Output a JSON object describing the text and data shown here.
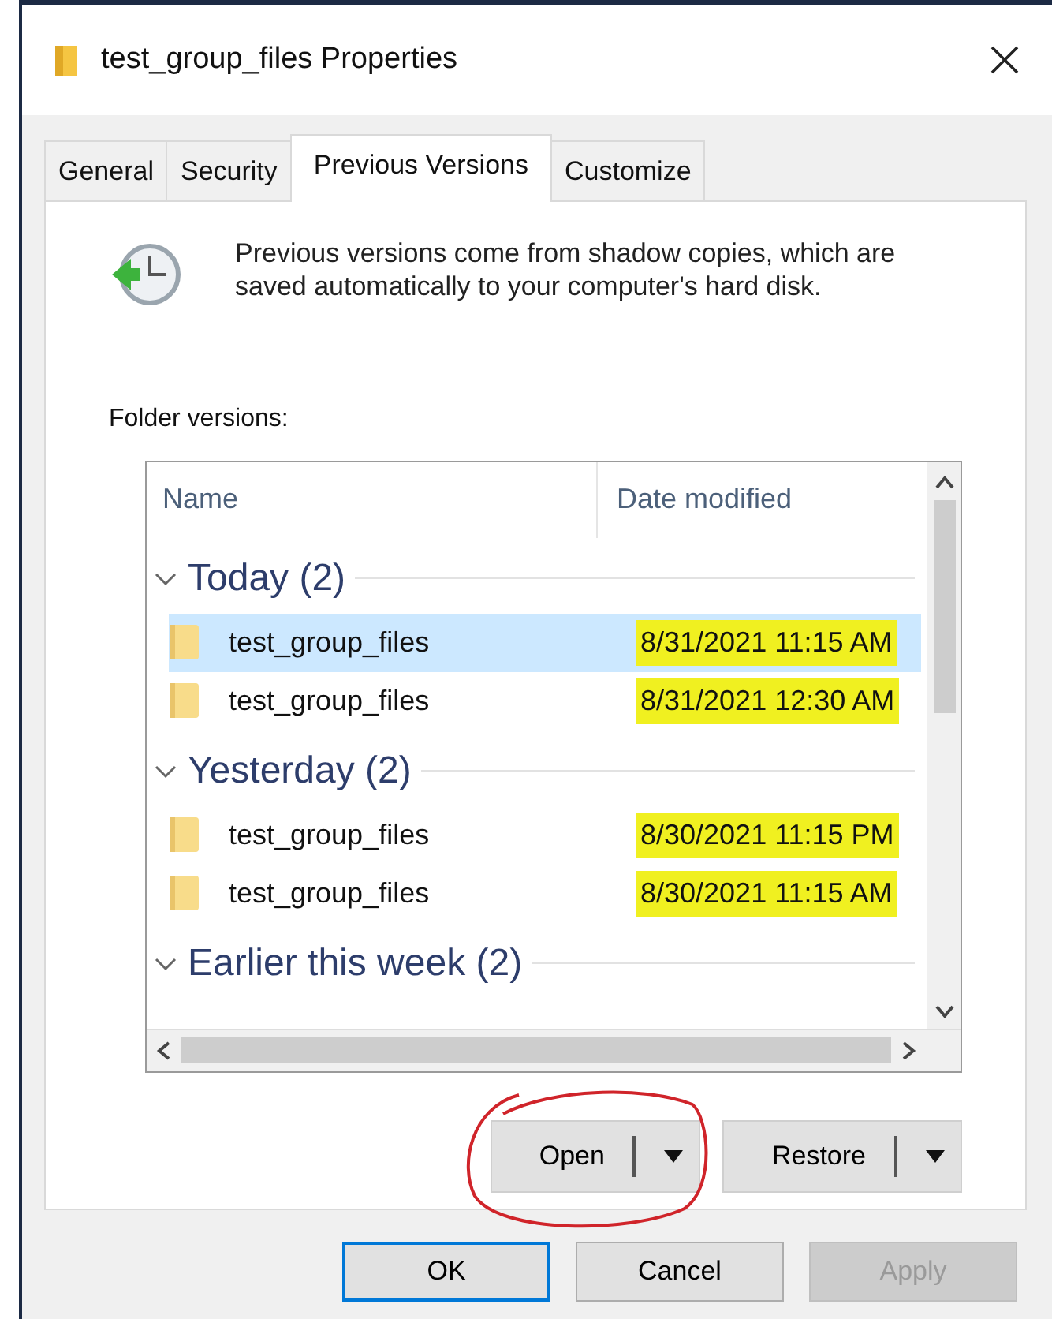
{
  "window": {
    "title": "test_group_files Properties"
  },
  "tabs": [
    {
      "label": "General",
      "selected": false
    },
    {
      "label": "Security",
      "selected": false
    },
    {
      "label": "Previous Versions",
      "selected": true
    },
    {
      "label": "Customize",
      "selected": false
    }
  ],
  "info_text": "Previous versions come from shadow copies, which are saved automatically to your computer's hard disk.",
  "list_label": "Folder versions:",
  "table": {
    "columns": [
      "Name",
      "Date modified"
    ],
    "groups": [
      {
        "label": "Today (2)",
        "expanded": true,
        "rows": [
          {
            "name": "test_group_files",
            "date": "8/31/2021 11:15 AM",
            "selected": true,
            "highlighted": true
          },
          {
            "name": "test_group_files",
            "date": "8/31/2021 12:30 AM",
            "selected": false,
            "highlighted": true
          }
        ]
      },
      {
        "label": "Yesterday (2)",
        "expanded": true,
        "rows": [
          {
            "name": "test_group_files",
            "date": "8/30/2021 11:15 PM",
            "selected": false,
            "highlighted": true
          },
          {
            "name": "test_group_files",
            "date": "8/30/2021 11:15 AM",
            "selected": false,
            "highlighted": true
          }
        ]
      },
      {
        "label": "Earlier this week (2)",
        "expanded": true
      }
    ]
  },
  "actions": [
    {
      "label": "Open",
      "circled": true
    },
    {
      "label": "Restore",
      "circled": false
    }
  ],
  "buttons": [
    {
      "label": "OK",
      "disabled": false,
      "default": true
    },
    {
      "label": "Cancel",
      "disabled": false,
      "default": false
    },
    {
      "label": "Apply",
      "disabled": true,
      "default": false
    }
  ]
}
